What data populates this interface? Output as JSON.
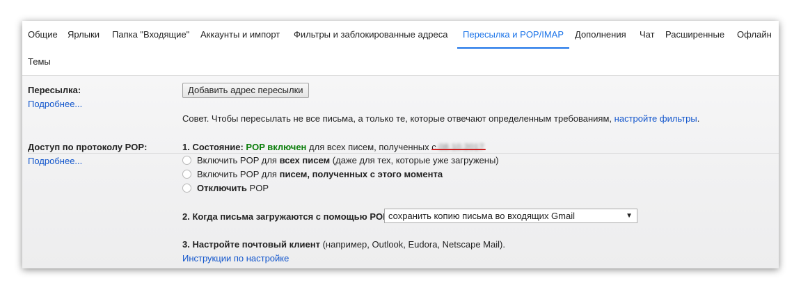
{
  "tabs": [
    {
      "label": "Общие"
    },
    {
      "label": "Ярлыки"
    },
    {
      "label": "Папка \"Входящие\""
    },
    {
      "label": "Аккаунты и импорт"
    },
    {
      "label": "Фильтры и заблокированные адреса"
    },
    {
      "label": "Пересылка и POP/IMAP",
      "active": true
    },
    {
      "label": "Дополнения"
    },
    {
      "label": "Чат"
    },
    {
      "label": "Расширенные"
    },
    {
      "label": "Офлайн"
    },
    {
      "label": "Темы"
    }
  ],
  "forwarding": {
    "title": "Пересылка:",
    "more_link": "Подробнее...",
    "add_button": "Добавить адрес пересылки",
    "tip_text": "Совет. Чтобы пересылать не все письма, а только те, которые отвечают определенным требованиям,",
    "tip_link": "настройте фильтры",
    "tip_end": "."
  },
  "pop": {
    "title": "Доступ по протоколу POP:",
    "more_link": "Подробнее...",
    "status": {
      "prefix": "1. Состояние:",
      "state": "POP включен",
      "suffix": "для всех писем, полученных с",
      "date_blurred": "08.10.2017"
    },
    "options": [
      {
        "pre": "Включить POP для",
        "bold": "всех писем",
        "post": "(даже для тех, которые уже загружены)"
      },
      {
        "pre": "Включить POP для",
        "bold": "писем, полученных с этого момента",
        "post": ""
      },
      {
        "pre": "",
        "bold": "Отключить",
        "post": "POP"
      }
    ],
    "when_label": "2. Когда письма загружаются с помощью POP",
    "when_value": "сохранить копию письма во входящих Gmail",
    "client_label": "3. Настройте почтовый клиент",
    "client_hint": "(например, Outlook, Eudora, Netscape Mail).",
    "instructions_link": "Инструкции по настройке"
  },
  "colors": {
    "accent": "#1a73e8",
    "link": "#1155cc",
    "status_green": "#0a7d0a",
    "annotation_red": "#cc2222"
  },
  "icons": {
    "select_arrow": "dropdown-arrow-icon",
    "radio": "radio-button-icon"
  }
}
